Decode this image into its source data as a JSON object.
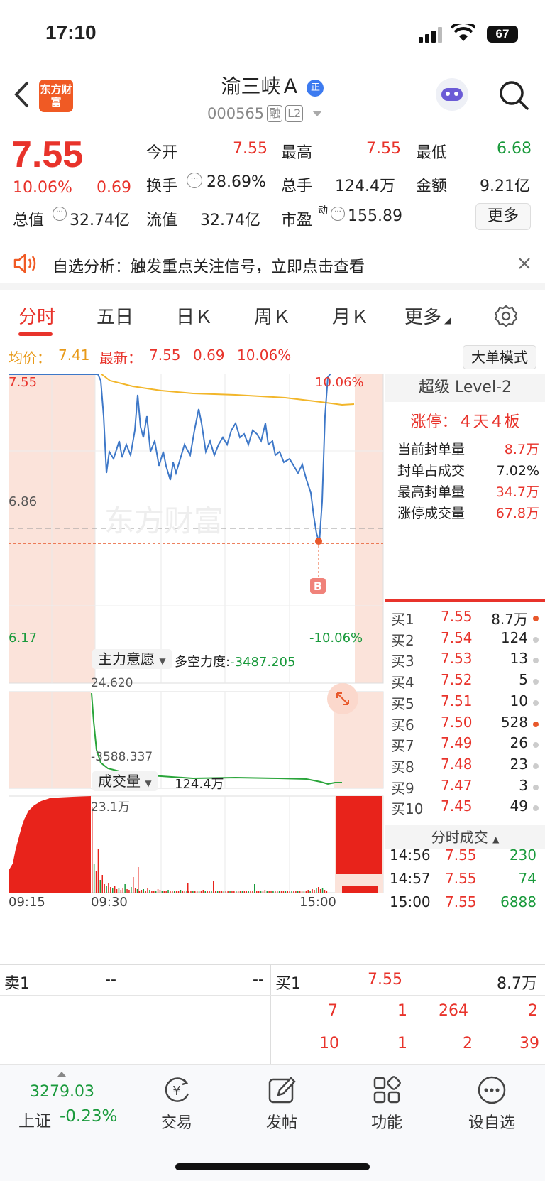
{
  "status": {
    "time": "17:10",
    "battery": "67"
  },
  "header": {
    "title": "渝三峡Ａ",
    "code": "000565",
    "tag_rong": "融",
    "tag_l2": "L2",
    "logo": "东方财富"
  },
  "quote": {
    "price": "7.55",
    "pct": "10.06%",
    "chg": "0.69",
    "open_label": "今开",
    "open": "7.55",
    "high_label": "最高",
    "high": "7.55",
    "low_label": "最低",
    "low": "6.68",
    "turnover_label": "换手",
    "turnover": "28.69%",
    "vol_label": "总手",
    "vol": "124.4万",
    "amount_label": "金额",
    "amount": "9.21亿",
    "mcap_label": "总值",
    "mcap": "32.74亿",
    "float_label": "流值",
    "float": "32.74亿",
    "pe_label": "市盈",
    "pe_sup": "动",
    "pe": "155.89",
    "more": "更多"
  },
  "notice": {
    "text": "自选分析：触发重点关注信号，立即点击查看"
  },
  "tabs": [
    "分时",
    "五日",
    "日Ｋ",
    "周Ｋ",
    "月Ｋ",
    "更多"
  ],
  "info": {
    "avg_label": "均价：",
    "avg": "7.41",
    "latest_label": "最新：",
    "latest": "7.55",
    "chg": "0.69",
    "pct": "10.06%",
    "mode_btn": "大单模式"
  },
  "chart": {
    "top_left": "7.55",
    "top_right": "10.06%",
    "mid_left": "6.86",
    "bottom_left": "6.17",
    "bottom_right": "-10.06%",
    "marker": "B",
    "ind_label": "主力意愿",
    "ind_desc_label": "多空力度:",
    "ind_desc": "-3487.205",
    "ind_high": "24.620",
    "ind_low": "-3588.337",
    "vol_label": "成交量",
    "vol_total": "124.4万",
    "vol_max": "23.1万",
    "times": [
      "09:15",
      "09:30",
      "15:00"
    ],
    "watermark": "东方财富"
  },
  "chart_data": {
    "type": "line",
    "title": "",
    "xlabel": "",
    "ylabel": "",
    "ylim": [
      6.17,
      7.55
    ],
    "x_ticks": [
      "09:15",
      "09:30",
      "15:00"
    ],
    "series": []
  },
  "level2": {
    "title": "超级 Level-2",
    "limit": "涨停：４天４板",
    "stats": [
      {
        "label": "当前封单量",
        "value": "8.7万"
      },
      {
        "label": "封单占成交",
        "value": "7.02%"
      },
      {
        "label": "最高封单量",
        "value": "34.7万"
      },
      {
        "label": "涨停成交量",
        "value": "67.8万"
      }
    ]
  },
  "book": [
    {
      "label": "买1",
      "price": "7.55",
      "vol": "8.7万",
      "dot": "#e8582b"
    },
    {
      "label": "买2",
      "price": "7.54",
      "vol": "124",
      "dot": "#ccc"
    },
    {
      "label": "买3",
      "price": "7.53",
      "vol": "13",
      "dot": "#ccc"
    },
    {
      "label": "买4",
      "price": "7.52",
      "vol": "5",
      "dot": "#ccc"
    },
    {
      "label": "买5",
      "price": "7.51",
      "vol": "10",
      "dot": "#ccc"
    },
    {
      "label": "买6",
      "price": "7.50",
      "vol": "528",
      "dot": "#e8582b"
    },
    {
      "label": "买7",
      "price": "7.49",
      "vol": "26",
      "dot": "#ccc"
    },
    {
      "label": "买8",
      "price": "7.48",
      "vol": "23",
      "dot": "#ccc"
    },
    {
      "label": "买9",
      "price": "7.47",
      "vol": "3",
      "dot": "#ccc"
    },
    {
      "label": "买10",
      "price": "7.45",
      "vol": "49",
      "dot": "#ccc"
    }
  ],
  "ticks_title": "分时成交",
  "ticks": [
    {
      "time": "14:56",
      "price": "7.55",
      "vol": "230"
    },
    {
      "time": "14:57",
      "price": "7.55",
      "vol": "74"
    },
    {
      "time": "15:00",
      "price": "7.55",
      "vol": "6888"
    }
  ],
  "bottom": {
    "sell_label": "卖1",
    "sell_price": "--",
    "sell_vol": "--",
    "buy_label": "买1",
    "buy_price": "7.55",
    "buy_vol": "8.7万",
    "row1": [
      "7",
      "1",
      "264",
      "2"
    ],
    "row2": [
      "10",
      "1",
      "2",
      "39"
    ]
  },
  "tabbar": {
    "index_value": "3279.03",
    "index_name": "上证",
    "index_pct": "-0.23%",
    "items": [
      "交易",
      "发帖",
      "功能",
      "设自选"
    ]
  }
}
